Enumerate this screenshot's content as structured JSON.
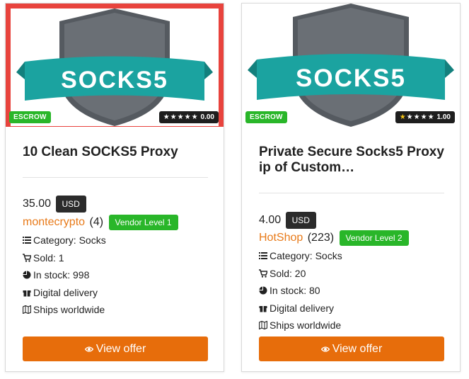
{
  "cards": [
    {
      "escrow": "ESCROW",
      "rating": {
        "stars_filled": 0,
        "max_stars": 5,
        "score": "0.00",
        "star_glyph": "★"
      },
      "logo_text": "SOCKS5",
      "title": "10 Clean SOCKS5 Proxy",
      "price": "35.00",
      "currency": "USD",
      "vendor": {
        "name": "montecrypto",
        "count": "(4)",
        "level": "Vendor Level 1"
      },
      "meta": {
        "category": "Category: Socks",
        "sold": "Sold: 1",
        "stock": "In stock: 998",
        "delivery": "Digital delivery",
        "ships": "Ships worldwide"
      },
      "button": "View offer",
      "thumb_border_color": "#e8433d"
    },
    {
      "escrow": "ESCROW",
      "rating": {
        "stars_filled": 1,
        "max_stars": 5,
        "score": "1.00",
        "star_glyph": "★"
      },
      "logo_text": "SOCKS5",
      "title": "Private Secure Socks5 Proxy ip of Custom…",
      "price": "4.00",
      "currency": "USD",
      "vendor": {
        "name": "HotShop",
        "count": "(223)",
        "level": "Vendor Level 2"
      },
      "meta": {
        "category": "Category: Socks",
        "sold": "Sold: 20",
        "stock": "In stock: 80",
        "delivery": "Digital delivery",
        "ships": "Ships worldwide"
      },
      "button": "View offer"
    }
  ],
  "colors": {
    "accent_orange": "#e76d0b",
    "vendor_link": "#e87a19",
    "badge_green": "#29b629",
    "shield_gray": "#555a60",
    "banner_teal": "#1ba3a0",
    "star_gold": "#f5c518"
  }
}
